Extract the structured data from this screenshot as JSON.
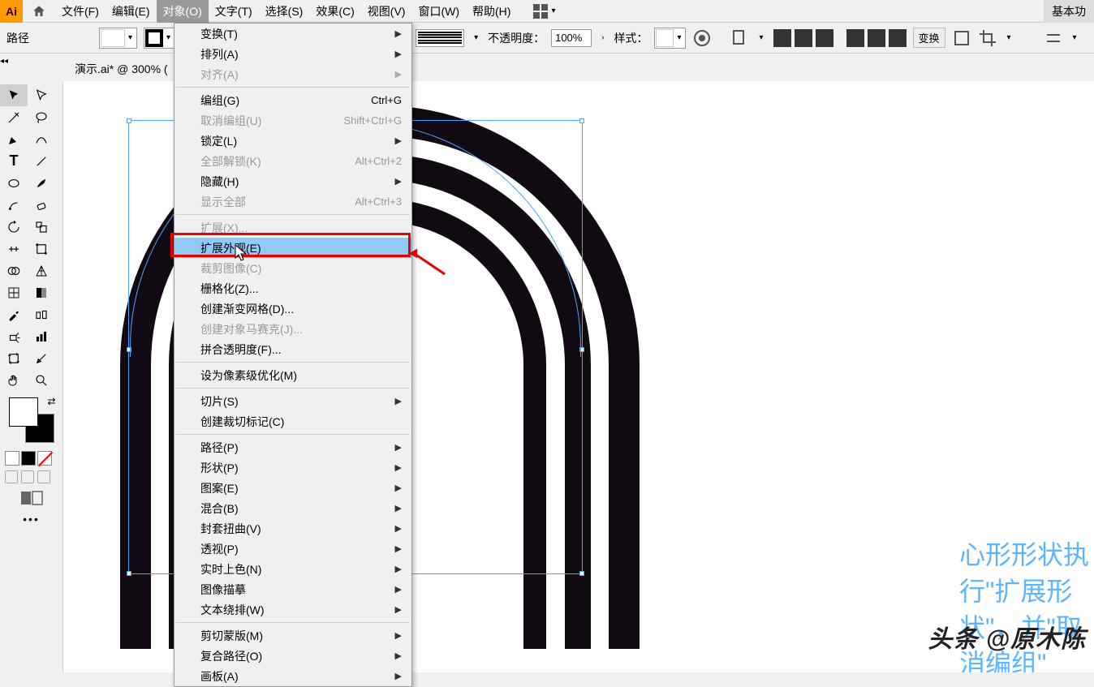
{
  "app": {
    "logo": "Ai"
  },
  "menubar": {
    "items": [
      {
        "label": "文件(F)"
      },
      {
        "label": "编辑(E)"
      },
      {
        "label": "对象(O)"
      },
      {
        "label": "文字(T)"
      },
      {
        "label": "选择(S)"
      },
      {
        "label": "效果(C)"
      },
      {
        "label": "视图(V)"
      },
      {
        "label": "窗口(W)"
      },
      {
        "label": "帮助(H)"
      }
    ],
    "essentials": "基本功"
  },
  "options": {
    "path_label": "路径",
    "opacity_label": "不透明度：",
    "opacity_value": "100%",
    "style_label": "样式：",
    "transform_btn": "变换"
  },
  "doc_tab": "演示.ai* @ 300% (",
  "dropdown": {
    "items": [
      {
        "label": "变换(T)",
        "sub": true
      },
      {
        "label": "排列(A)",
        "sub": true
      },
      {
        "label": "对齐(A)",
        "sub": true,
        "disabled": true
      },
      {
        "sep": true
      },
      {
        "label": "编组(G)",
        "shortcut": "Ctrl+G"
      },
      {
        "label": "取消编组(U)",
        "shortcut": "Shift+Ctrl+G",
        "disabled": true
      },
      {
        "label": "锁定(L)",
        "sub": true
      },
      {
        "label": "全部解锁(K)",
        "shortcut": "Alt+Ctrl+2",
        "disabled": true
      },
      {
        "label": "隐藏(H)",
        "sub": true
      },
      {
        "label": "显示全部",
        "shortcut": "Alt+Ctrl+3",
        "disabled": true
      },
      {
        "sep": true
      },
      {
        "label": "扩展(X)...",
        "disabled": true
      },
      {
        "label": "扩展外观(E)",
        "highlighted": true
      },
      {
        "label": "裁剪图像(C)",
        "disabled": true
      },
      {
        "label": "栅格化(Z)..."
      },
      {
        "label": "创建渐变网格(D)..."
      },
      {
        "label": "创建对象马赛克(J)...",
        "disabled": true
      },
      {
        "label": "拼合透明度(F)..."
      },
      {
        "sep": true
      },
      {
        "label": "设为像素级优化(M)"
      },
      {
        "sep": true
      },
      {
        "label": "切片(S)",
        "sub": true
      },
      {
        "label": "创建裁切标记(C)"
      },
      {
        "sep": true
      },
      {
        "label": "路径(P)",
        "sub": true
      },
      {
        "label": "形状(P)",
        "sub": true
      },
      {
        "label": "图案(E)",
        "sub": true
      },
      {
        "label": "混合(B)",
        "sub": true
      },
      {
        "label": "封套扭曲(V)",
        "sub": true
      },
      {
        "label": "透视(P)",
        "sub": true
      },
      {
        "label": "实时上色(N)",
        "sub": true
      },
      {
        "label": "图像描摹",
        "sub": true
      },
      {
        "label": "文本绕排(W)",
        "sub": true
      },
      {
        "sep": true
      },
      {
        "label": "剪切蒙版(M)",
        "sub": true
      },
      {
        "label": "复合路径(O)",
        "sub": true
      },
      {
        "label": "画板(A)",
        "sub": true
      }
    ]
  },
  "annotation": {
    "line1": "心形形状执",
    "line2": "行\"扩展形",
    "line3": "状\"，并\"取",
    "line4": "消编组\""
  },
  "watermark": "头条 @原木陈",
  "tools_more": "•••"
}
